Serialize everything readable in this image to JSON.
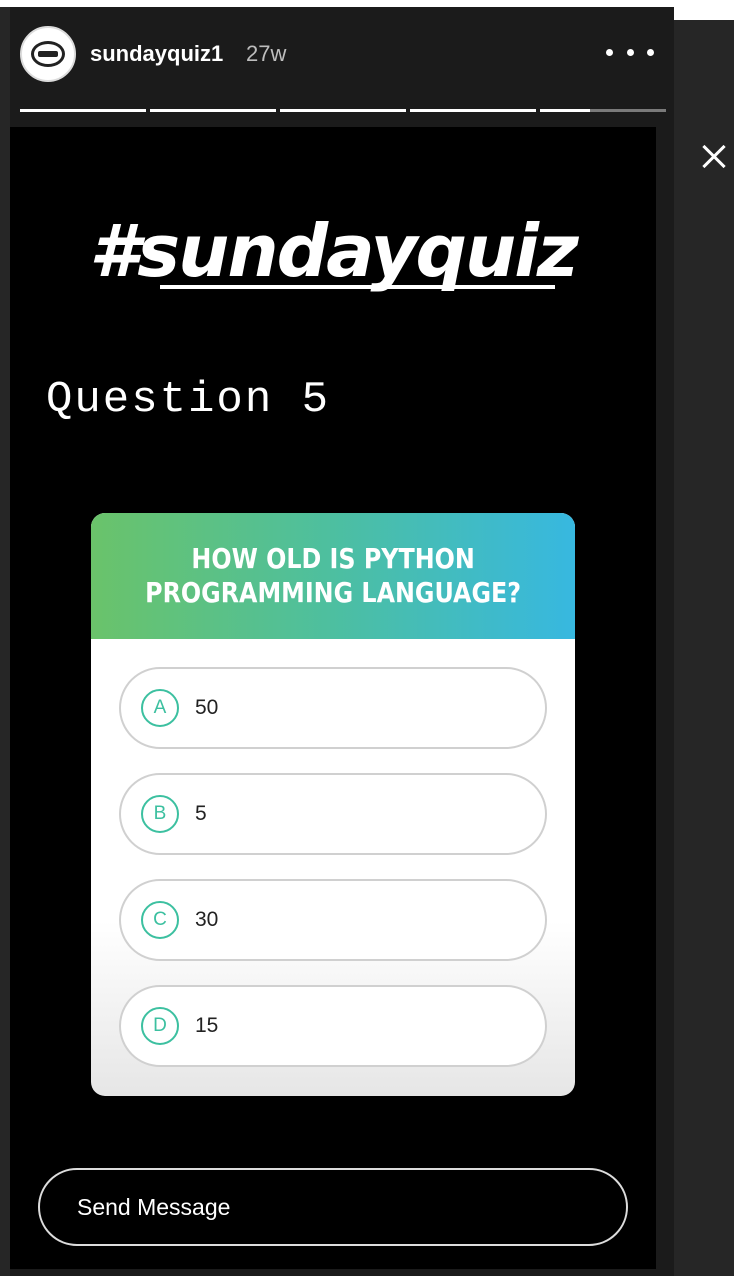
{
  "header": {
    "username": "sundayquiz1",
    "time_ago": "27w"
  },
  "story": {
    "hashtag": "#sundayquiz",
    "question_label": "Question 5"
  },
  "quiz": {
    "question": "HOW OLD IS PYTHON\nPROGRAMMING LANGUAGE?",
    "options": [
      {
        "letter": "A",
        "text": "50"
      },
      {
        "letter": "B",
        "text": "5"
      },
      {
        "letter": "C",
        "text": "30"
      },
      {
        "letter": "D",
        "text": "15"
      }
    ]
  },
  "footer": {
    "send_message_placeholder": "Send Message"
  }
}
